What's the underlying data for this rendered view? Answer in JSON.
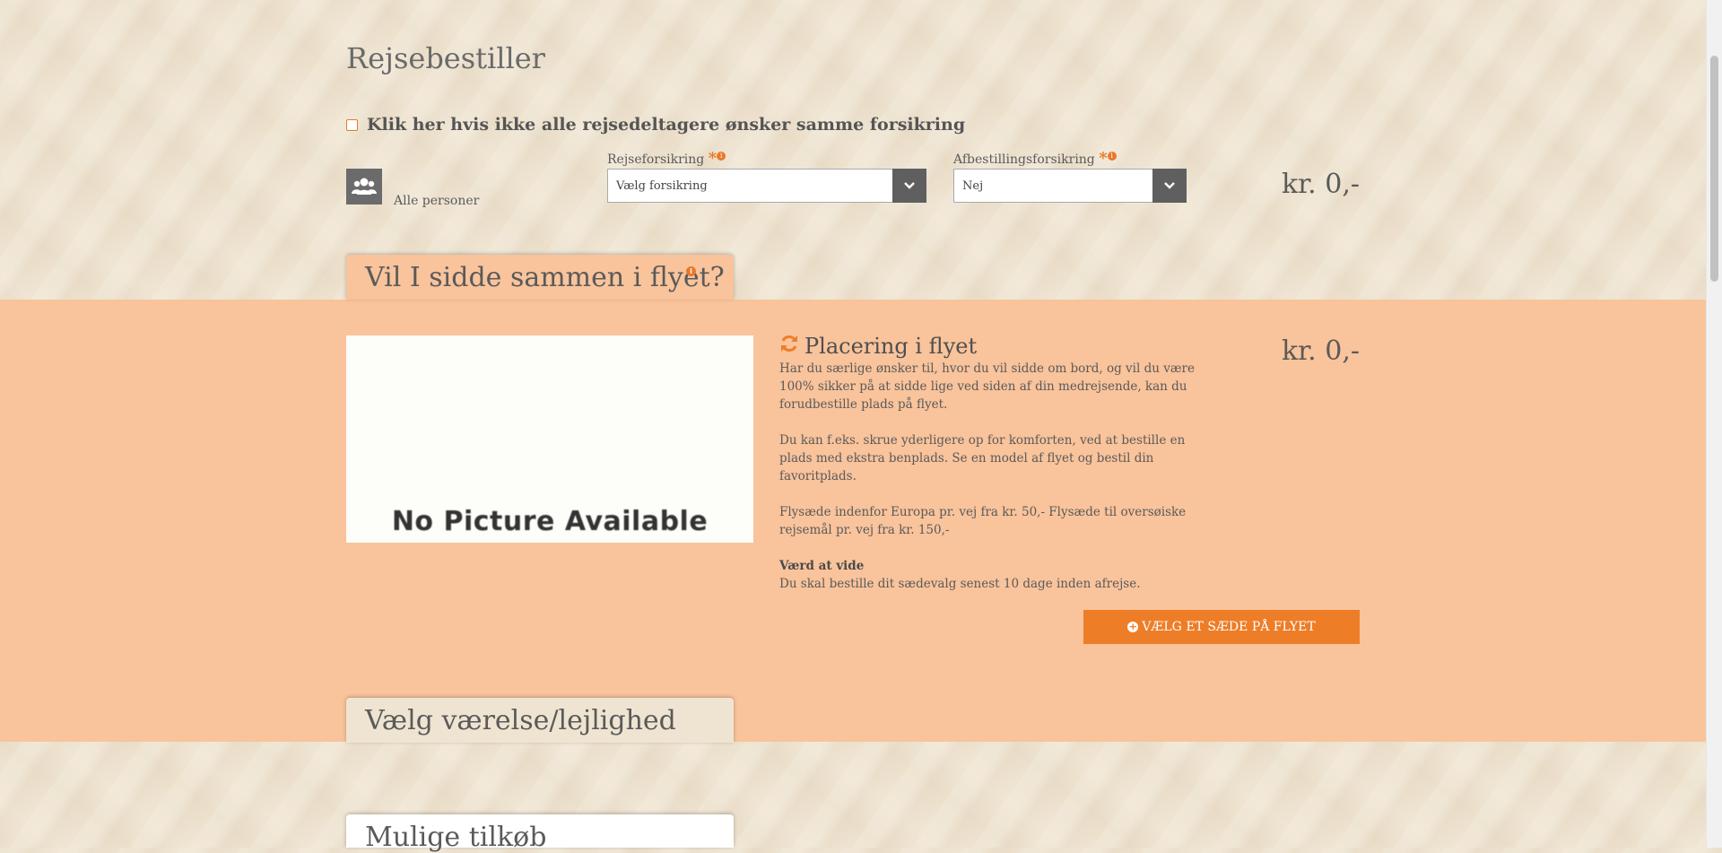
{
  "booker": {
    "title": "Rejsebestiller",
    "different_insurance_label": "Klik her hvis ikke alle rejsedeltagere ønsker samme forsikring"
  },
  "insurance": {
    "person_label": "Alle personer",
    "travel_label": "Rejseforsikring",
    "travel_value": "Vælg forsikring",
    "cancel_label": "Afbestillingsforsikring",
    "cancel_value": "Nej",
    "required_mark": "*",
    "price": "kr. 0,-"
  },
  "seating": {
    "tab_title": "Vil I sidde sammen i flyet?",
    "image_text": "No Picture Available",
    "title": "Placering i flyet",
    "p1": "Har du særlige ønsker til, hvor du vil sidde om bord, og vil du være 100% sikker på at sidde lige ved siden af din medrejsende, kan du forudbestille plads på flyet.",
    "p2": "Du kan f.eks. skrue yderligere op for komforten, ved at bestille en plads med ekstra benplads. Se en model af flyet og bestil din favoritplads.",
    "p3": "Flysæde indenfor Europa pr. vej fra kr. 50,- Flysæde til oversøiske rejsemål pr. vej fra kr. 150,-",
    "note_title": "Værd at vide",
    "note_text": "Du skal bestille dit sædevalg senest 10 dage inden afrejse.",
    "price": "kr. 0,-",
    "cta_label": "VÆLG ET SÆDE PÅ FLYET"
  },
  "room": {
    "tab_title": "Vælg værelse/lejlighed"
  },
  "extras": {
    "tab_title": "Mulige tilkøb"
  },
  "colors": {
    "accent": "#ee7d28",
    "band": "#f9c39b",
    "background": "#efe4d1"
  }
}
